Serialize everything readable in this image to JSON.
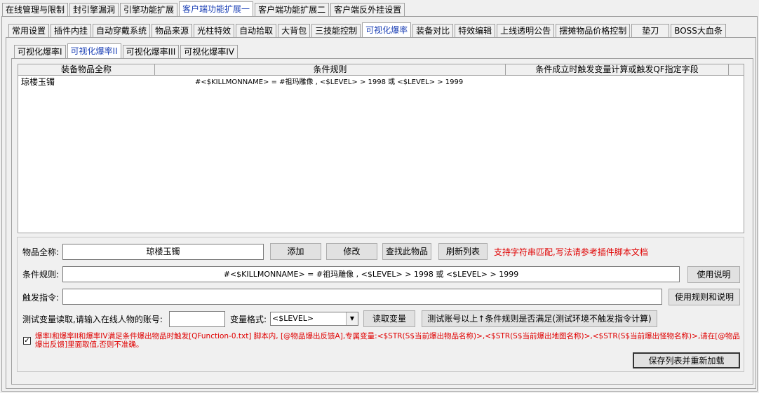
{
  "top_tabs": [
    "在线管理与限制",
    "封引擎漏洞",
    "引擎功能扩展",
    "客户端功能扩展一",
    "客户端功能扩展二",
    "客户端反外挂设置"
  ],
  "second_tabs": [
    "常用设置",
    "插件内挂",
    "自动穿戴系统",
    "物品来源",
    "光柱特效",
    "自动拾取",
    "大背包",
    "三技能控制",
    "可视化爆率",
    "装备对比",
    "特效编辑",
    "上线透明公告",
    "摆摊物品价格控制",
    "垫刀",
    "BOSS大血条"
  ],
  "third_tabs": [
    "可视化爆率I",
    "可视化爆率II",
    "可视化爆率III",
    "可视化爆率IV"
  ],
  "grid": {
    "headers": [
      "装备物品全称",
      "条件规则",
      "条件成立时触发变量计算或触发QF指定字段"
    ],
    "rows": [
      {
        "name": "琼楼玉镯",
        "rule": "#<$KILLMONNAME> = #祖玛雕像 , <$LEVEL> > 1998 或 <$LEVEL> > 1999",
        "trigger": ""
      }
    ]
  },
  "form": {
    "item_label": "物品全称:",
    "item_value": "琼楼玉镯",
    "add_button": "添加",
    "edit_button": "修改",
    "find_button": "查找此物品",
    "refresh_button": "刷新列表",
    "match_hint": "支持字符串匹配,写法请参考插件脚本文档",
    "rule_label": "条件规则:",
    "rule_value": "#<$KILLMONNAME> = #祖玛雕像 , <$LEVEL> > 1998 或 <$LEVEL> > 1999",
    "usage_button": "使用说明",
    "trigger_label": "触发指令:",
    "trigger_value": "",
    "rule_usage_button": "使用规则和说明",
    "test_label": "测试变量读取,请输入在线人物的账号:",
    "account_value": "",
    "var_format_label": "变量格式:",
    "var_format_value": "<$LEVEL>",
    "read_var_button": "读取变量",
    "test_rule_button": "测试账号以上↑条件规则是否满足(测试环境不触发指令计算)",
    "checkbox_checked": true,
    "note_text": "爆率I和爆率II和爆率IV满足条件爆出物品时触发[QFunction-0.txt] 脚本内, [@物品爆出反馈A],专属变量:<$STR(S$当前爆出物品名称)>,<$STR(S$当前爆出地图名称)>,<$STR(S$当前爆出怪物名称)>,请在[@物品爆出反馈]里面取值,否则不准确。",
    "save_button": "保存列表并重新加载"
  },
  "colors": {
    "active_tab": "#1a3fb5",
    "hint_red": "#e00000",
    "window_bg": "#f0f0f0"
  }
}
